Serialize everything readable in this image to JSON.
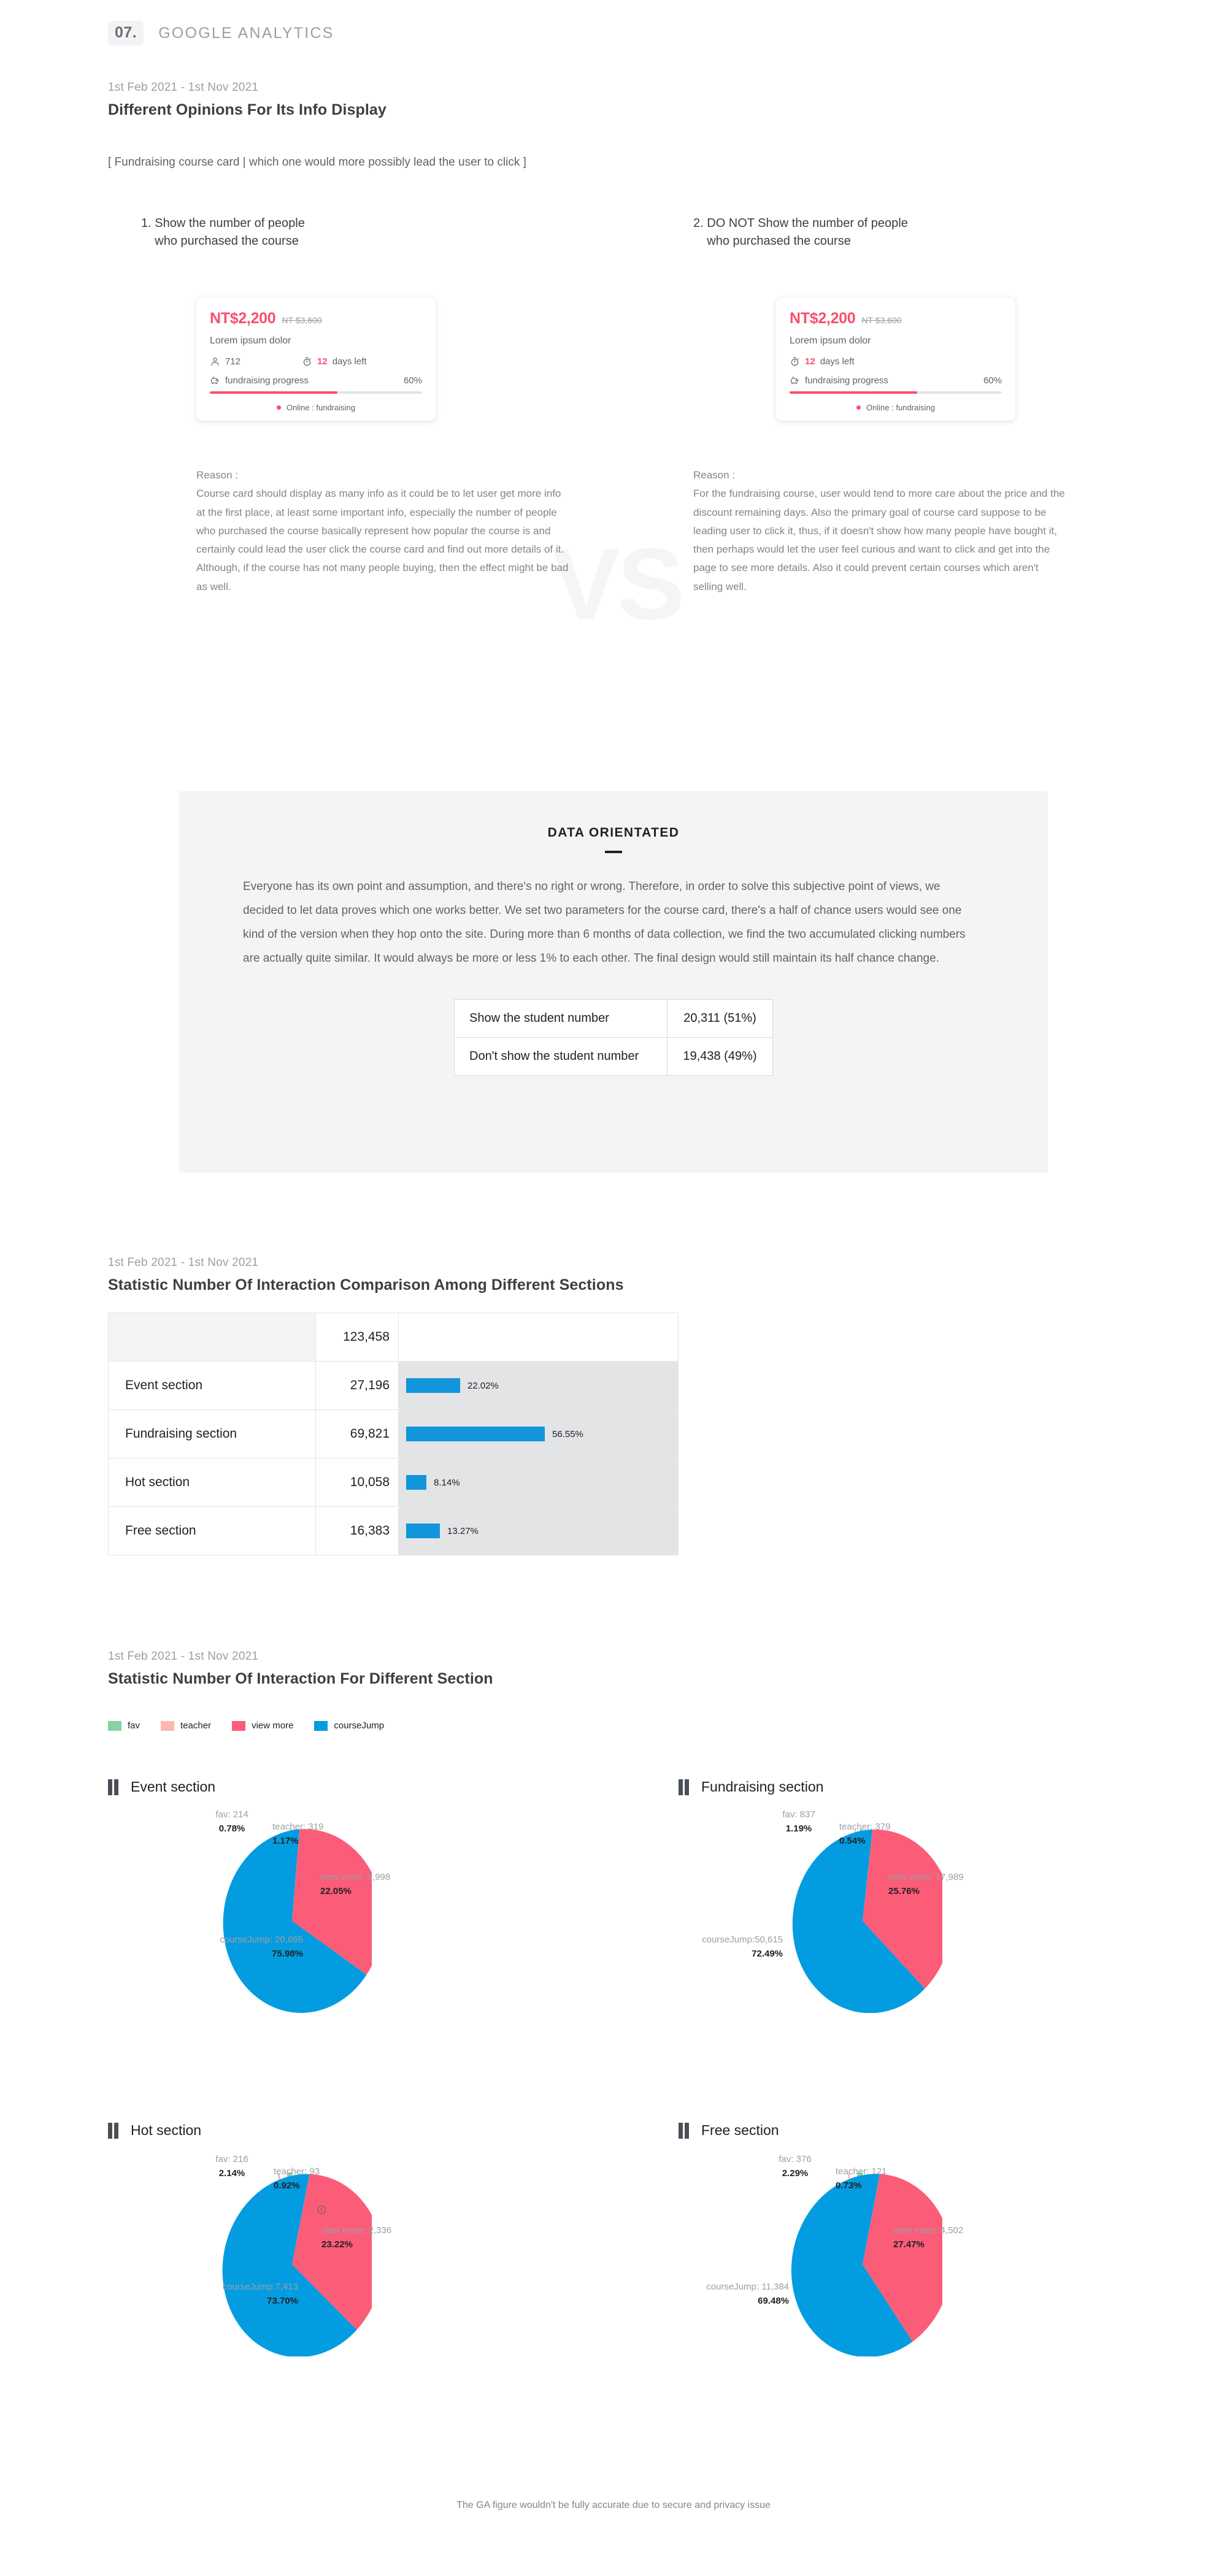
{
  "header": {
    "number": "07.",
    "title": "GOOGLE ANALYTICS"
  },
  "section_opinions": {
    "daterange": "1st Feb 2021 - 1st Nov 2021",
    "title": "Different Opinions For Its Info Display",
    "caption": "[ Fundraising course card | which one would more possibly lead the user to click ]",
    "vs_label": "VS",
    "options": [
      {
        "number": "1.",
        "title_line1": "Show the number of people",
        "title_line2": "who purchased the course",
        "reason_heading": "Reason :",
        "reason_body": "Course card should display as many info as it could be to let user get more info at the first place, at least some important info, especially the number of people who purchased the course basically represent how popular the course is and certainly could lead the user click the course card and find out more details of it. Although, if the course has not many people buying, then the effect might be bad as well.",
        "card": {
          "price_new": "NT$2,200",
          "price_old": "NT $3,600",
          "subtitle": "Lorem ipsum dolor",
          "show_people": true,
          "people_icon": "person-icon",
          "people_count": "712",
          "clock_icon": "stopwatch-icon",
          "days_number": "12",
          "days_text": "days left",
          "piggy_icon": "piggy-bank-icon",
          "progress_label": "fundraising progress",
          "progress_pct_text": "60%",
          "progress_pct": 60,
          "status_text": "Online : fundraising"
        }
      },
      {
        "number": "2.",
        "title_line1": "DO NOT Show the number of people",
        "title_line2": "who purchased the course",
        "reason_heading": "Reason :",
        "reason_body": "For the fundraising course, user would tend to more care about the price and the discount remaining days. Also the primary goal of course card suppose to be leading user to click it, thus, if it doesn't show how many people have bought it, then perhaps would let the user feel curious and want to click and get into the page to see more details. Also it could prevent certain courses which aren't selling well.",
        "card": {
          "price_new": "NT$2,200",
          "price_old": "NT $3,600",
          "subtitle": "Lorem ipsum dolor",
          "show_people": false,
          "people_icon": "person-icon",
          "people_count": "",
          "clock_icon": "stopwatch-icon",
          "days_number": "12",
          "days_text": "days left",
          "piggy_icon": "piggy-bank-icon",
          "progress_label": "fundraising progress",
          "progress_pct_text": "60%",
          "progress_pct": 60,
          "status_text": "Online : fundraising"
        }
      }
    ]
  },
  "data_orientated": {
    "title": "DATA ORIENTATED",
    "paragraph": "Everyone has its own point and assumption, and there's no right or wrong. Therefore, in order to solve this subjective point of views, we decided to let data proves which one works better. We set two parameters for the course card, there's a half of chance users would see one kind of the version when they hop onto the site. During more than 6 months of data collection, we find the two accumulated clicking numbers are actually quite similar. It would always be more or less 1% to each other.  The final design would still maintain its half chance change.",
    "rows": [
      {
        "label": "Show the student number",
        "value": "20,311 (51%)"
      },
      {
        "label": "Don't show the student number",
        "value": "19,438 (49%)"
      }
    ]
  },
  "section_comparison": {
    "daterange": "1st Feb 2021 - 1st Nov 2021",
    "title": "Statistic Number Of Interaction Comparison Among Different Sections"
  },
  "section_pies": {
    "daterange": "1st Feb 2021 - 1st Nov 2021",
    "title": "Statistic Number Of Interaction For Different Section"
  },
  "footer": {
    "note": "The GA figure wouldn't be fully accurate due to secure and privacy issue"
  },
  "colors": {
    "accent_pink": "#fb4e6d",
    "accent_blue": "#1195db",
    "pie_blue": "#039ce0",
    "pie_pink": "#fb5c78",
    "pie_green": "#84d3a0",
    "pie_peach": "#fbb8ae",
    "grey_text": "#9aa0a6",
    "panel_grey": "#f4f4f4"
  },
  "chart_data": [
    {
      "type": "bar",
      "title": "Statistic Number Of Interaction Comparison Among Different Sections",
      "orientation": "horizontal",
      "total_label": "",
      "total_value": "123,458",
      "categories": [
        "Event section",
        "Fundraising section",
        "Hot section",
        "Free section"
      ],
      "values": [
        27196,
        69821,
        10058,
        16383
      ],
      "value_labels": [
        "27,196",
        "69,821",
        "10,058",
        "16,383"
      ],
      "percents": [
        22.02,
        56.55,
        8.14,
        13.27
      ],
      "percent_labels": [
        "22.02%",
        "56.55%",
        "8.14%",
        "13.27%"
      ],
      "xlabel": "",
      "ylabel": "",
      "grid": false,
      "legend": "none",
      "bar_color": "#1195db"
    },
    {
      "type": "pie",
      "title": "Statistic Number Of Interaction For Different Section",
      "legend": [
        "fav",
        "teacher",
        "view more",
        "courseJump"
      ],
      "legend_position": "top-left",
      "legend_colors": [
        "#84d3a0",
        "#fbb8ae",
        "#fb5c78",
        "#039ce0"
      ],
      "charts": [
        {
          "name": "Event section",
          "has_warning_icon": false,
          "slices": [
            {
              "label": "fav",
              "value": 214,
              "value_label": "fav: 214",
              "percent": 0.78,
              "percent_label": "0.78%",
              "color": "#84d3a0"
            },
            {
              "label": "teacher",
              "value": 319,
              "value_label": "teacher: 319",
              "percent": 1.17,
              "percent_label": "1.17%",
              "color": "#fbb8ae"
            },
            {
              "label": "view more",
              "value": 5998,
              "value_label": "view more: 5,998",
              "percent": 22.05,
              "percent_label": "22.05%",
              "color": "#fb5c78"
            },
            {
              "label": "courseJump",
              "value": 20665,
              "value_label": "courseJump: 20,665",
              "percent": 75.98,
              "percent_label": "75.98%",
              "color": "#039ce0"
            }
          ]
        },
        {
          "name": "Fundraising section",
          "has_warning_icon": false,
          "slices": [
            {
              "label": "fav",
              "value": 837,
              "value_label": "fav: 837",
              "percent": 1.19,
              "percent_label": "1.19%",
              "color": "#84d3a0"
            },
            {
              "label": "teacher",
              "value": 379,
              "value_label": "teacher: 379",
              "percent": 0.54,
              "percent_label": "0.54%",
              "color": "#fbb8ae"
            },
            {
              "label": "view more",
              "value": 17989,
              "value_label": "view more: 17,989",
              "percent": 25.76,
              "percent_label": "25.76%",
              "color": "#fb5c78"
            },
            {
              "label": "courseJump",
              "value": 50615,
              "value_label": "courseJump:50,615",
              "percent": 72.49,
              "percent_label": "72.49%",
              "color": "#039ce0"
            }
          ]
        },
        {
          "name": "Hot section",
          "has_warning_icon": true,
          "slices": [
            {
              "label": "fav",
              "value": 216,
              "value_label": "fav: 216",
              "percent": 2.14,
              "percent_label": "2.14%",
              "color": "#84d3a0"
            },
            {
              "label": "teacher",
              "value": 93,
              "value_label": "teacher: 93",
              "percent": 0.92,
              "percent_label": "0.92%",
              "color": "#fbb8ae"
            },
            {
              "label": "view more",
              "value": 2336,
              "value_label": "view more: 2,336",
              "percent": 23.22,
              "percent_label": "23.22%",
              "color": "#fb5c78"
            },
            {
              "label": "courseJump",
              "value": 7413,
              "value_label": "courseJump:7,413",
              "percent": 73.7,
              "percent_label": "73.70%",
              "color": "#039ce0"
            }
          ]
        },
        {
          "name": "Free section",
          "has_warning_icon": false,
          "slices": [
            {
              "label": "fav",
              "value": 376,
              "value_label": "fav: 376",
              "percent": 2.29,
              "percent_label": "2.29%",
              "color": "#84d3a0"
            },
            {
              "label": "teacher",
              "value": 121,
              "value_label": "teacher: 121",
              "percent": 0.73,
              "percent_label": "0.73%",
              "color": "#fbb8ae"
            },
            {
              "label": "view more",
              "value": 4502,
              "value_label": "view more: 4,502",
              "percent": 27.47,
              "percent_label": "27.47%",
              "color": "#fb5c78"
            },
            {
              "label": "courseJump",
              "value": 11384,
              "value_label": "courseJump: 11,384",
              "percent": 69.48,
              "percent_label": "69.48%",
              "color": "#039ce0"
            }
          ]
        }
      ]
    }
  ]
}
